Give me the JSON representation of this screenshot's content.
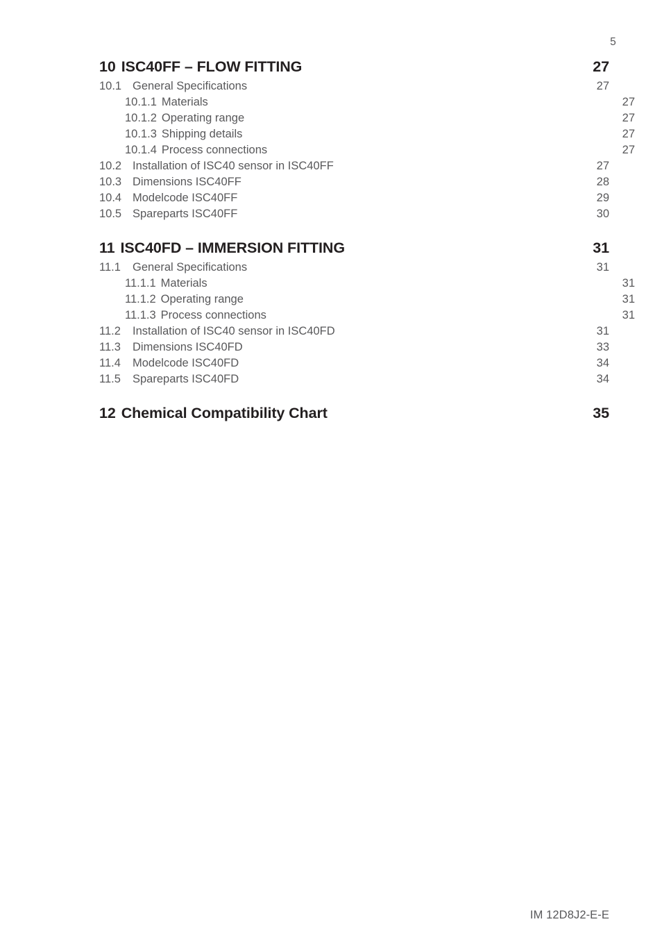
{
  "page": {
    "page_number": "5",
    "footer_code": "IM 12D8J2-E-E",
    "text_color_body": "#58585a",
    "text_color_heading": "#231f20",
    "background": "#ffffff"
  },
  "toc": {
    "groups": [
      {
        "heading": {
          "number": "10",
          "title": "ISC40FF – FLOW FITTING",
          "page": "27"
        },
        "entries": [
          {
            "level": 2,
            "number": "10.1",
            "title": "General Specifications",
            "page": "27"
          },
          {
            "level": 3,
            "number": "10.1.1",
            "title": "Materials",
            "page": "27"
          },
          {
            "level": 3,
            "number": "10.1.2",
            "title": "Operating range",
            "page": "27"
          },
          {
            "level": 3,
            "number": "10.1.3",
            "title": "Shipping details",
            "page": "27"
          },
          {
            "level": 3,
            "number": "10.1.4",
            "title": "Process connections",
            "page": "27"
          },
          {
            "level": 2,
            "number": "10.2",
            "title": "Installation of ISC40 sensor in ISC40FF",
            "page": "27"
          },
          {
            "level": 2,
            "number": "10.3",
            "title": "Dimensions ISC40FF",
            "page": "28"
          },
          {
            "level": 2,
            "number": "10.4",
            "title": "Modelcode ISC40FF",
            "page": "29"
          },
          {
            "level": 2,
            "number": "10.5",
            "title": "Spareparts ISC40FF",
            "page": "30"
          }
        ]
      },
      {
        "heading": {
          "number": "11",
          "title": "ISC40FD – IMMERSION FITTING",
          "page": "31"
        },
        "entries": [
          {
            "level": 2,
            "number": "11.1",
            "title": "General Specifications",
            "page": "31"
          },
          {
            "level": 3,
            "number": "11.1.1",
            "title": "Materials",
            "page": "31"
          },
          {
            "level": 3,
            "number": "11.1.2",
            "title": "Operating range",
            "page": "31"
          },
          {
            "level": 3,
            "number": "11.1.3",
            "title": "Process connections",
            "page": "31"
          },
          {
            "level": 2,
            "number": "11.2",
            "title": "Installation of ISC40 sensor in ISC40FD",
            "page": "31"
          },
          {
            "level": 2,
            "number": "11.3",
            "title": "Dimensions ISC40FD",
            "page": "33"
          },
          {
            "level": 2,
            "number": "11.4",
            "title": "Modelcode ISC40FD",
            "page": "34"
          },
          {
            "level": 2,
            "number": "11.5",
            "title": "Spareparts ISC40FD",
            "page": "34"
          }
        ]
      },
      {
        "heading": {
          "number": "12",
          "title": "Chemical Compatibility Chart",
          "page": "35"
        },
        "entries": []
      }
    ]
  }
}
